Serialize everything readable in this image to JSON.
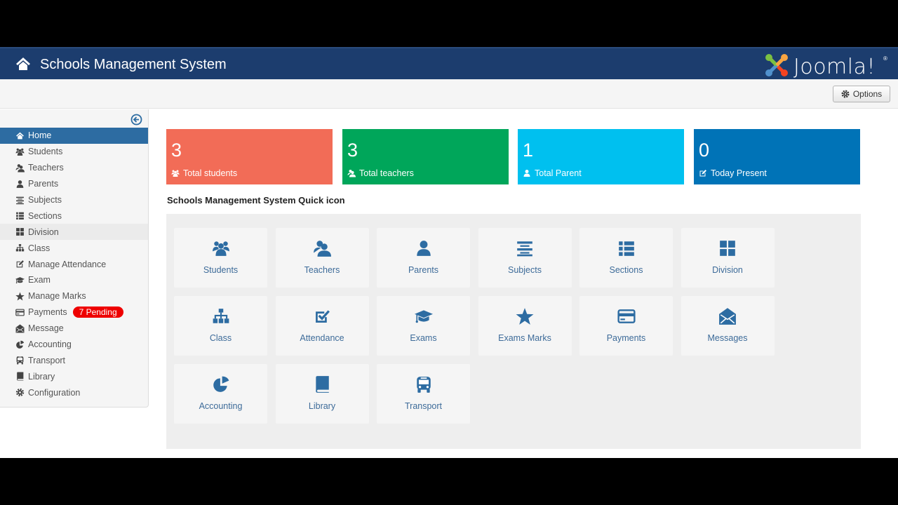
{
  "header": {
    "title": "Schools Management System",
    "brand": "Joomla!",
    "brand_mark": "®"
  },
  "toolbar": {
    "options_label": "Options"
  },
  "sidebar": {
    "collapse_icon": "circle-arrow-left-icon",
    "items": [
      {
        "label": "Home",
        "icon": "home-icon",
        "active": true
      },
      {
        "label": "Students",
        "icon": "users-icon"
      },
      {
        "label": "Teachers",
        "icon": "user-group-icon"
      },
      {
        "label": "Parents",
        "icon": "user-icon"
      },
      {
        "label": "Subjects",
        "icon": "align-center-icon"
      },
      {
        "label": "Sections",
        "icon": "list-icon"
      },
      {
        "label": "Division",
        "icon": "grid-icon",
        "hover": true
      },
      {
        "label": "Class",
        "icon": "sitemap-icon"
      },
      {
        "label": "Manage Attendance",
        "icon": "edit-icon"
      },
      {
        "label": "Exam",
        "icon": "graduation-cap-icon"
      },
      {
        "label": "Manage Marks",
        "icon": "star-icon"
      },
      {
        "label": "Payments",
        "icon": "credit-card-icon",
        "badge": "7 Pending"
      },
      {
        "label": "Message",
        "icon": "envelope-open-icon"
      },
      {
        "label": "Accounting",
        "icon": "pie-chart-icon"
      },
      {
        "label": "Transport",
        "icon": "bus-icon"
      },
      {
        "label": "Library",
        "icon": "book-icon"
      },
      {
        "label": "Configuration",
        "icon": "cog-icon"
      }
    ]
  },
  "stats": [
    {
      "value": "3",
      "label": "Total students",
      "icon": "users-icon",
      "color": "#f26c57"
    },
    {
      "value": "3",
      "label": "Total teachers",
      "icon": "user-group-icon",
      "color": "#00a65a"
    },
    {
      "value": "1",
      "label": "Total Parent",
      "icon": "user-icon",
      "color": "#00c0ef"
    },
    {
      "value": "0",
      "label": "Today Present",
      "icon": "edit-icon",
      "color": "#0073b7"
    }
  ],
  "quick_icons": {
    "title": "Schools Management System Quick icon",
    "items": [
      {
        "label": "Students",
        "icon": "users-icon"
      },
      {
        "label": "Teachers",
        "icon": "user-group-icon"
      },
      {
        "label": "Parents",
        "icon": "user-icon"
      },
      {
        "label": "Subjects",
        "icon": "align-center-icon"
      },
      {
        "label": "Sections",
        "icon": "list-icon"
      },
      {
        "label": "Division",
        "icon": "grid-icon"
      },
      {
        "label": "Class",
        "icon": "sitemap-icon"
      },
      {
        "label": "Attendance",
        "icon": "check-square-icon"
      },
      {
        "label": "Exams",
        "icon": "graduation-cap-icon"
      },
      {
        "label": "Exams Marks",
        "icon": "star-icon"
      },
      {
        "label": "Payments",
        "icon": "credit-card-icon"
      },
      {
        "label": "Messages",
        "icon": "envelope-open-icon"
      },
      {
        "label": "Accounting",
        "icon": "pie-chart-icon"
      },
      {
        "label": "Library",
        "icon": "book-icon"
      },
      {
        "label": "Transport",
        "icon": "bus-icon"
      }
    ]
  },
  "colors": {
    "header_bg": "#1c3d6e",
    "active_nav": "#2d6ca2",
    "icon_blue": "#2d6ca2",
    "badge_red": "#ee0000"
  }
}
